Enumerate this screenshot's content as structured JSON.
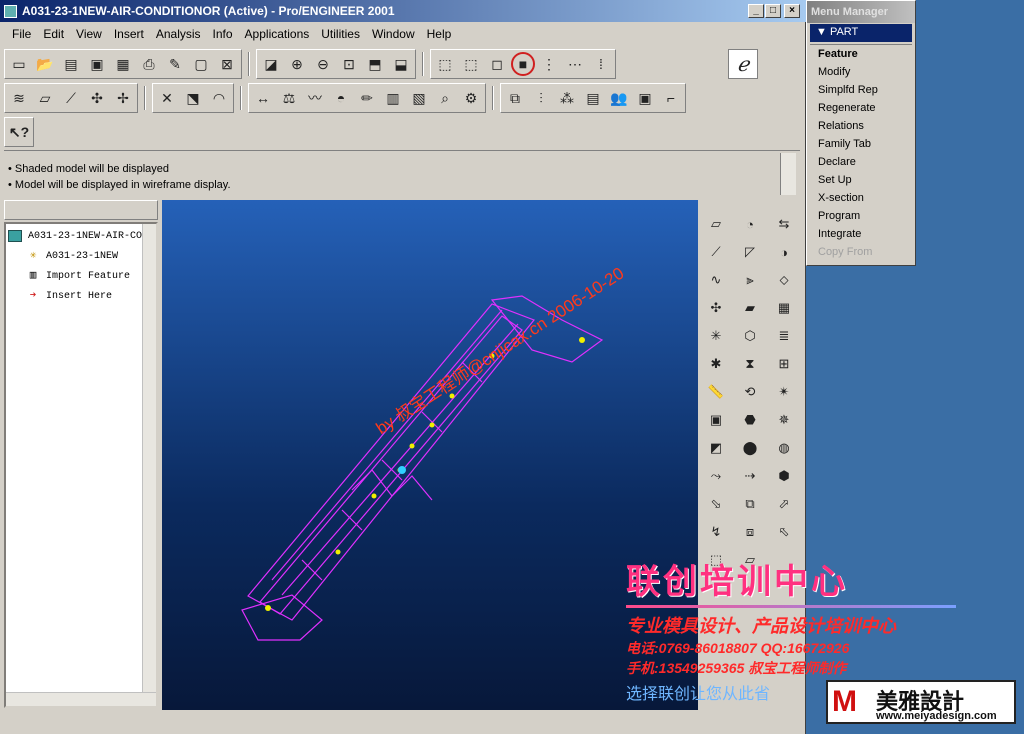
{
  "window": {
    "title": "A031-23-1NEW-AIR-CONDITIONOR (Active) - Pro/ENGINEER 2001",
    "min": "_",
    "max": "□",
    "close": "×"
  },
  "menu": [
    "File",
    "Edit",
    "View",
    "Insert",
    "Analysis",
    "Info",
    "Applications",
    "Utilities",
    "Window",
    "Help"
  ],
  "messages": [
    "• Shaded model will be displayed",
    "• Model will be displayed in wireframe display."
  ],
  "tree": {
    "root": "A031-23-1NEW-AIR-CO",
    "items": [
      "A031-23-1NEW",
      "Import Feature",
      "Insert Here"
    ]
  },
  "menu_manager": {
    "title": "Menu Manager",
    "section": "PART",
    "items": [
      "Feature",
      "Modify",
      "Simplfd Rep",
      "Regenerate",
      "Relations",
      "Family Tab",
      "Declare",
      "Set Up",
      "X-section",
      "Program",
      "Integrate",
      "Copy From"
    ]
  },
  "watermark": {
    "diagonal": "by 叔宝工程师@cnjicax.cn 2006-10-20",
    "center_name": "联创培训中心",
    "slogan": "专业模具设计、产品设计培训中心",
    "phone": "电话:0769-86018807  QQ:16672926",
    "mobile": "手机:13549259365       叔宝工程师制作",
    "motto": "选择联创让您从此省",
    "brand": "美雅設計",
    "brand_url": "www.meiyadesign.com"
  }
}
